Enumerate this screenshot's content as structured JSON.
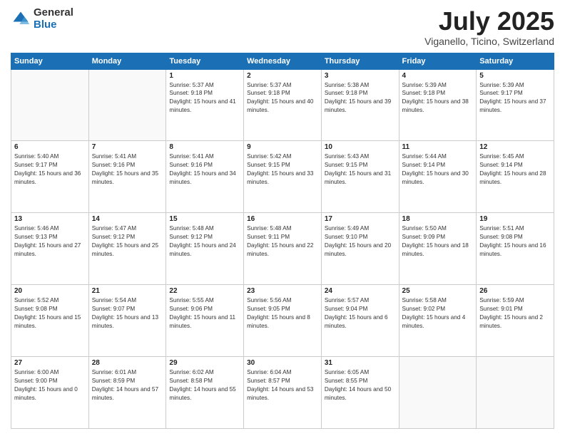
{
  "logo": {
    "general": "General",
    "blue": "Blue"
  },
  "title": {
    "month": "July 2025",
    "location": "Viganello, Ticino, Switzerland"
  },
  "weekdays": [
    "Sunday",
    "Monday",
    "Tuesday",
    "Wednesday",
    "Thursday",
    "Friday",
    "Saturday"
  ],
  "weeks": [
    [
      {
        "day": "",
        "info": ""
      },
      {
        "day": "",
        "info": ""
      },
      {
        "day": "1",
        "info": "Sunrise: 5:37 AM\nSunset: 9:18 PM\nDaylight: 15 hours and 41 minutes."
      },
      {
        "day": "2",
        "info": "Sunrise: 5:37 AM\nSunset: 9:18 PM\nDaylight: 15 hours and 40 minutes."
      },
      {
        "day": "3",
        "info": "Sunrise: 5:38 AM\nSunset: 9:18 PM\nDaylight: 15 hours and 39 minutes."
      },
      {
        "day": "4",
        "info": "Sunrise: 5:39 AM\nSunset: 9:18 PM\nDaylight: 15 hours and 38 minutes."
      },
      {
        "day": "5",
        "info": "Sunrise: 5:39 AM\nSunset: 9:17 PM\nDaylight: 15 hours and 37 minutes."
      }
    ],
    [
      {
        "day": "6",
        "info": "Sunrise: 5:40 AM\nSunset: 9:17 PM\nDaylight: 15 hours and 36 minutes."
      },
      {
        "day": "7",
        "info": "Sunrise: 5:41 AM\nSunset: 9:16 PM\nDaylight: 15 hours and 35 minutes."
      },
      {
        "day": "8",
        "info": "Sunrise: 5:41 AM\nSunset: 9:16 PM\nDaylight: 15 hours and 34 minutes."
      },
      {
        "day": "9",
        "info": "Sunrise: 5:42 AM\nSunset: 9:15 PM\nDaylight: 15 hours and 33 minutes."
      },
      {
        "day": "10",
        "info": "Sunrise: 5:43 AM\nSunset: 9:15 PM\nDaylight: 15 hours and 31 minutes."
      },
      {
        "day": "11",
        "info": "Sunrise: 5:44 AM\nSunset: 9:14 PM\nDaylight: 15 hours and 30 minutes."
      },
      {
        "day": "12",
        "info": "Sunrise: 5:45 AM\nSunset: 9:14 PM\nDaylight: 15 hours and 28 minutes."
      }
    ],
    [
      {
        "day": "13",
        "info": "Sunrise: 5:46 AM\nSunset: 9:13 PM\nDaylight: 15 hours and 27 minutes."
      },
      {
        "day": "14",
        "info": "Sunrise: 5:47 AM\nSunset: 9:12 PM\nDaylight: 15 hours and 25 minutes."
      },
      {
        "day": "15",
        "info": "Sunrise: 5:48 AM\nSunset: 9:12 PM\nDaylight: 15 hours and 24 minutes."
      },
      {
        "day": "16",
        "info": "Sunrise: 5:48 AM\nSunset: 9:11 PM\nDaylight: 15 hours and 22 minutes."
      },
      {
        "day": "17",
        "info": "Sunrise: 5:49 AM\nSunset: 9:10 PM\nDaylight: 15 hours and 20 minutes."
      },
      {
        "day": "18",
        "info": "Sunrise: 5:50 AM\nSunset: 9:09 PM\nDaylight: 15 hours and 18 minutes."
      },
      {
        "day": "19",
        "info": "Sunrise: 5:51 AM\nSunset: 9:08 PM\nDaylight: 15 hours and 16 minutes."
      }
    ],
    [
      {
        "day": "20",
        "info": "Sunrise: 5:52 AM\nSunset: 9:08 PM\nDaylight: 15 hours and 15 minutes."
      },
      {
        "day": "21",
        "info": "Sunrise: 5:54 AM\nSunset: 9:07 PM\nDaylight: 15 hours and 13 minutes."
      },
      {
        "day": "22",
        "info": "Sunrise: 5:55 AM\nSunset: 9:06 PM\nDaylight: 15 hours and 11 minutes."
      },
      {
        "day": "23",
        "info": "Sunrise: 5:56 AM\nSunset: 9:05 PM\nDaylight: 15 hours and 8 minutes."
      },
      {
        "day": "24",
        "info": "Sunrise: 5:57 AM\nSunset: 9:04 PM\nDaylight: 15 hours and 6 minutes."
      },
      {
        "day": "25",
        "info": "Sunrise: 5:58 AM\nSunset: 9:02 PM\nDaylight: 15 hours and 4 minutes."
      },
      {
        "day": "26",
        "info": "Sunrise: 5:59 AM\nSunset: 9:01 PM\nDaylight: 15 hours and 2 minutes."
      }
    ],
    [
      {
        "day": "27",
        "info": "Sunrise: 6:00 AM\nSunset: 9:00 PM\nDaylight: 15 hours and 0 minutes."
      },
      {
        "day": "28",
        "info": "Sunrise: 6:01 AM\nSunset: 8:59 PM\nDaylight: 14 hours and 57 minutes."
      },
      {
        "day": "29",
        "info": "Sunrise: 6:02 AM\nSunset: 8:58 PM\nDaylight: 14 hours and 55 minutes."
      },
      {
        "day": "30",
        "info": "Sunrise: 6:04 AM\nSunset: 8:57 PM\nDaylight: 14 hours and 53 minutes."
      },
      {
        "day": "31",
        "info": "Sunrise: 6:05 AM\nSunset: 8:55 PM\nDaylight: 14 hours and 50 minutes."
      },
      {
        "day": "",
        "info": ""
      },
      {
        "day": "",
        "info": ""
      }
    ]
  ]
}
